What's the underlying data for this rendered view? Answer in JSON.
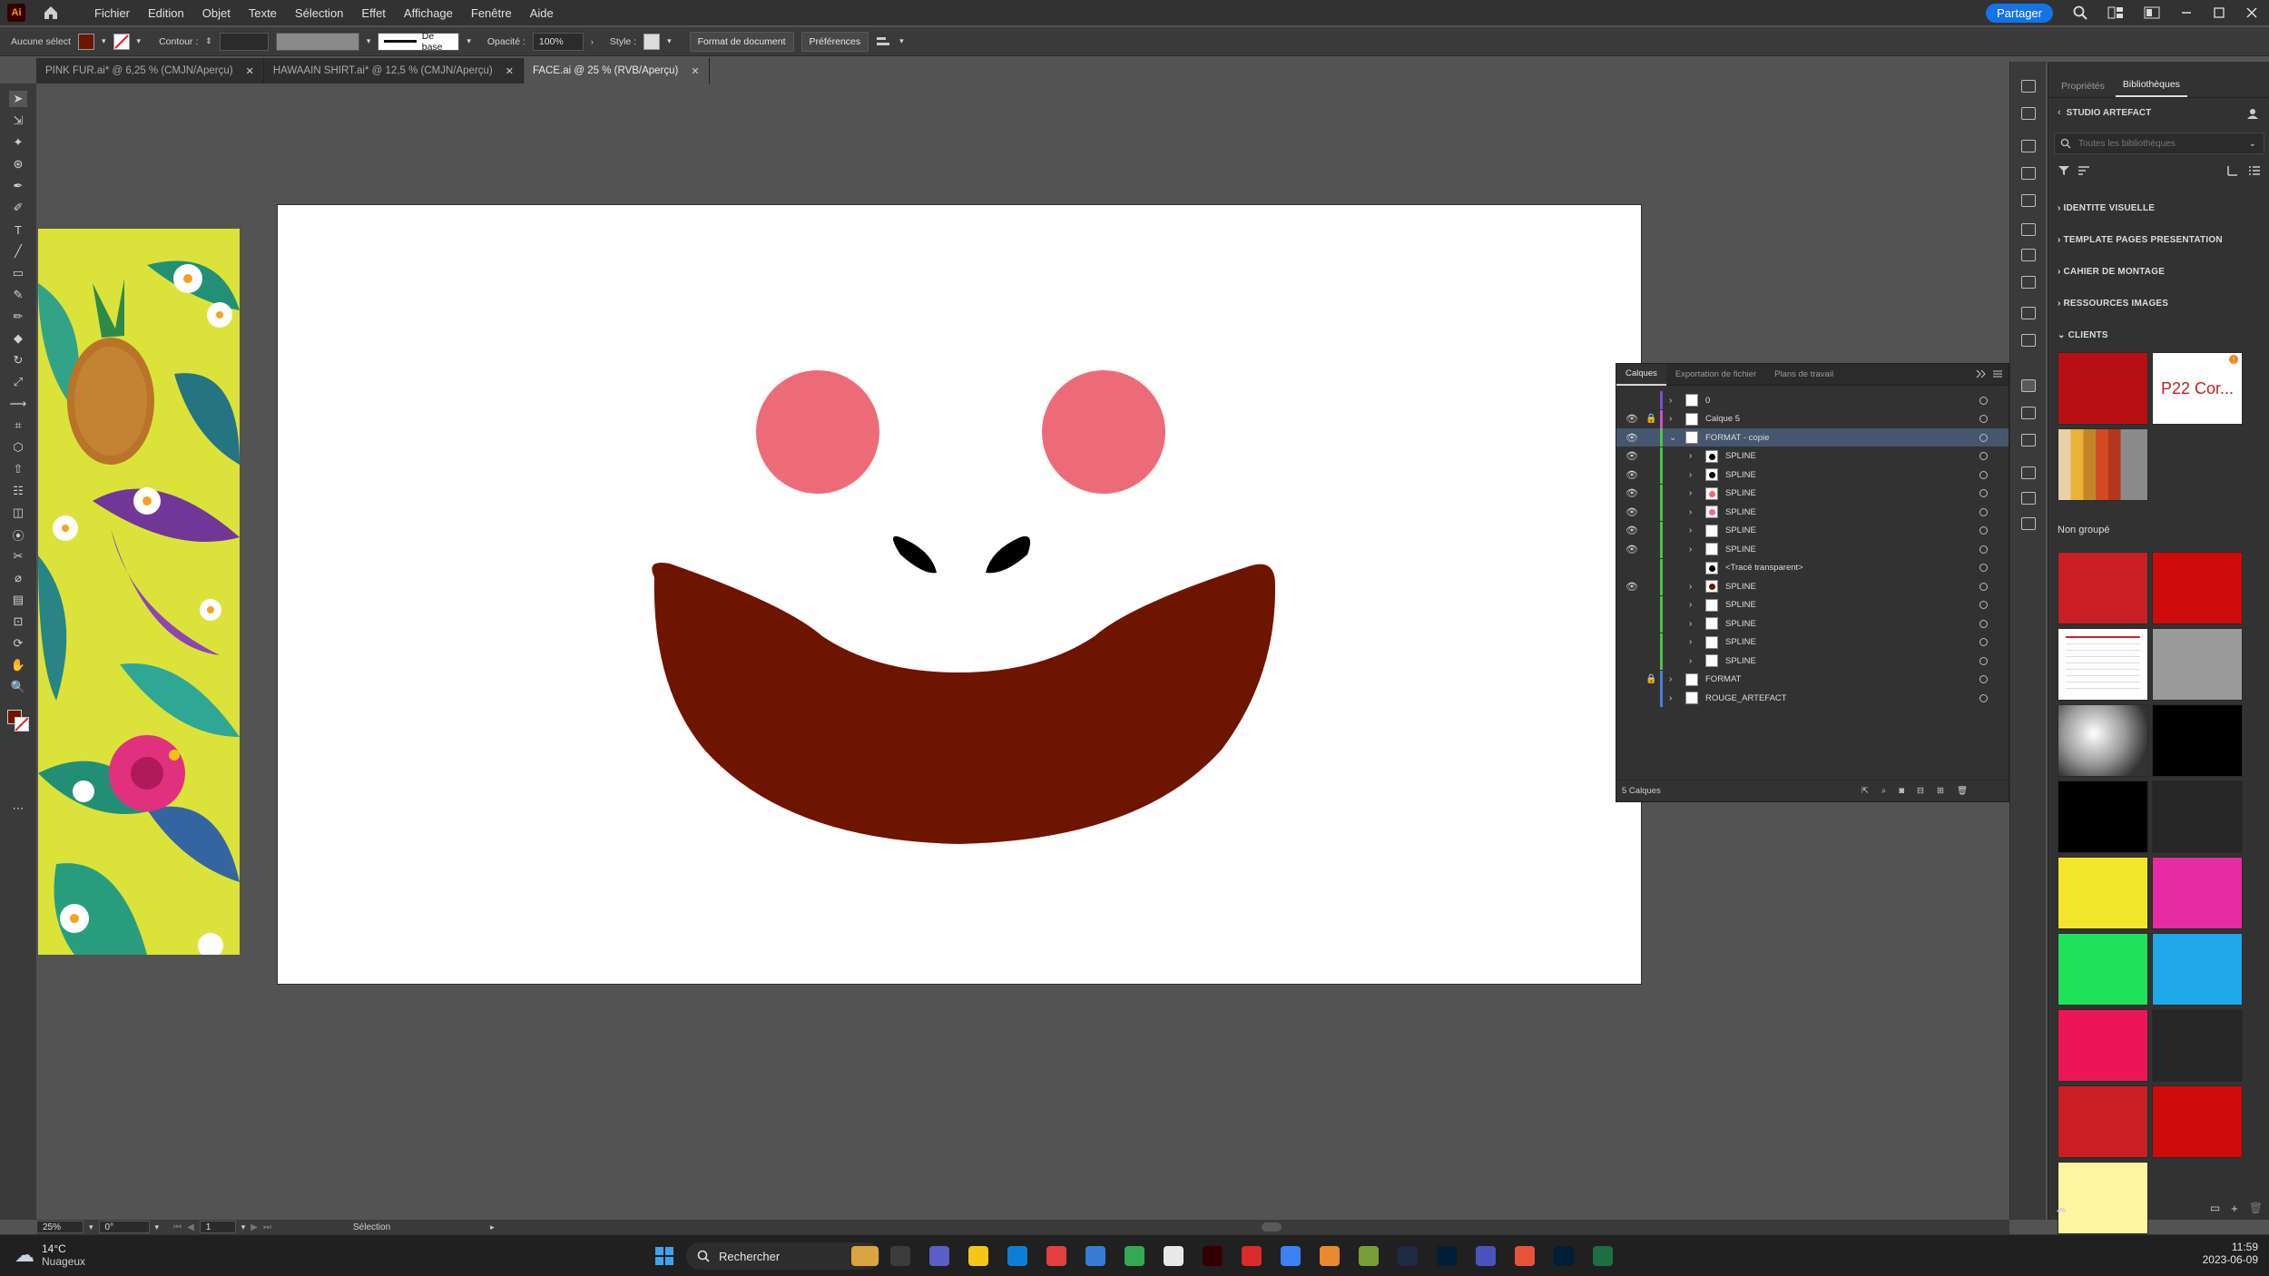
{
  "app": {
    "name": "Adobe Illustrator",
    "logo_text": "Ai",
    "menus": [
      "Fichier",
      "Edition",
      "Objet",
      "Texte",
      "Sélection",
      "Effet",
      "Affichage",
      "Fenêtre",
      "Aide"
    ],
    "share_label": "Partager"
  },
  "controlbar": {
    "selection_label": "Aucune sélect.",
    "fill_color": "#6e1500",
    "stroke_label": "Contour :",
    "stroke_style": "De base",
    "opacity_label": "Opacité :",
    "opacity_value": "100%",
    "style_label": "Style :",
    "doc_format_button": "Format de document",
    "preferences_button": "Préférences"
  },
  "tabs": [
    {
      "label": "PINK FUR.ai* @ 6,25 % (CMJN/Aperçu)",
      "active": false
    },
    {
      "label": "HAWAAIN SHIRT.ai* @ 12,5 % (CMJN/Aperçu)",
      "active": false
    },
    {
      "label": "FACE.ai @ 25 % (RVB/Aperçu)",
      "active": true
    }
  ],
  "artwork": {
    "cheek_color": "#ed6b78",
    "nose_color": "#000000",
    "mouth_color": "#6e1500"
  },
  "layers_panel": {
    "tabs": [
      "Calques",
      "Exportation de fichier",
      "Plans de travail"
    ],
    "active_tab": "Calques",
    "footer_count": "5 Calques",
    "rows": [
      {
        "name": "0",
        "visible": false,
        "locked": false,
        "level": 0,
        "expanded": false,
        "color": "#7b52d6"
      },
      {
        "name": "Calque 5",
        "visible": true,
        "locked": true,
        "level": 0,
        "expanded": false,
        "color": "#d14dd1"
      },
      {
        "name": "FORMAT - copie",
        "visible": true,
        "locked": false,
        "level": 0,
        "expanded": true,
        "selected": true,
        "color": "#4ac24a"
      },
      {
        "name": "SPLINE",
        "visible": true,
        "locked": false,
        "level": 1,
        "color": "#4ac24a"
      },
      {
        "name": "SPLINE",
        "visible": true,
        "locked": false,
        "level": 1,
        "color": "#4ac24a"
      },
      {
        "name": "SPLINE",
        "visible": true,
        "locked": false,
        "level": 1,
        "color": "#4ac24a"
      },
      {
        "name": "SPLINE",
        "visible": true,
        "locked": false,
        "level": 1,
        "color": "#4ac24a"
      },
      {
        "name": "SPLINE",
        "visible": true,
        "locked": false,
        "level": 1,
        "color": "#4ac24a"
      },
      {
        "name": "SPLINE",
        "visible": true,
        "locked": false,
        "level": 1,
        "color": "#4ac24a"
      },
      {
        "name": "<Tracé transparent>",
        "visible": false,
        "locked": false,
        "level": 1,
        "color": "#4ac24a"
      },
      {
        "name": "SPLINE",
        "visible": true,
        "locked": false,
        "level": 1,
        "color": "#4ac24a"
      },
      {
        "name": "SPLINE",
        "visible": false,
        "locked": false,
        "level": 1,
        "color": "#4ac24a"
      },
      {
        "name": "SPLINE",
        "visible": false,
        "locked": false,
        "level": 1,
        "color": "#4ac24a"
      },
      {
        "name": "SPLINE",
        "visible": false,
        "locked": false,
        "level": 1,
        "color": "#4ac24a"
      },
      {
        "name": "SPLINE",
        "visible": false,
        "locked": false,
        "level": 1,
        "color": "#4ac24a"
      },
      {
        "name": "FORMAT",
        "visible": false,
        "locked": true,
        "level": 0,
        "expanded": false,
        "color": "#4a7de0"
      },
      {
        "name": "ROUGE_ARTEFACT",
        "visible": false,
        "locked": false,
        "level": 0,
        "expanded": false,
        "color": "#4a7de0"
      }
    ]
  },
  "libraries_panel": {
    "tabs": [
      "Propriétés",
      "Bibliothèques"
    ],
    "active_tab": "Bibliothèques",
    "library_name": "STUDIO ARTEFACT",
    "search_placeholder": "Toutes les bibliothèques",
    "groups": [
      "IDENTITE VISUELLE",
      "TEMPLATE PAGES PRESENTATION",
      "CAHIER DE MONTAGE",
      "RESSOURCES IMAGES",
      "CLIENTS"
    ],
    "clients_swatch_label": "P22 Cor...",
    "non_groupe_label": "Non groupé",
    "swatches": [
      "#c81e24",
      "#cf0a0a",
      "#ffffff",
      "#9a9a9a",
      "#b0b0b0",
      "#000000",
      "#000000",
      "#262626",
      "#f2e62a",
      "#e62ba3",
      "#1fe25a",
      "#1ea8ea",
      "#ee1557",
      "#262626",
      "#c81e24",
      "#cf0a0a",
      "#fff5a0"
    ]
  },
  "statusbar": {
    "zoom": "25%",
    "rotation": "0°",
    "artboard_num": "1",
    "tool_name": "Sélection"
  },
  "taskbar": {
    "weather_temp": "14°C",
    "weather_desc": "Nuageux",
    "search_label": "Rechercher",
    "time": "11:59",
    "date": "2023-06-09"
  }
}
